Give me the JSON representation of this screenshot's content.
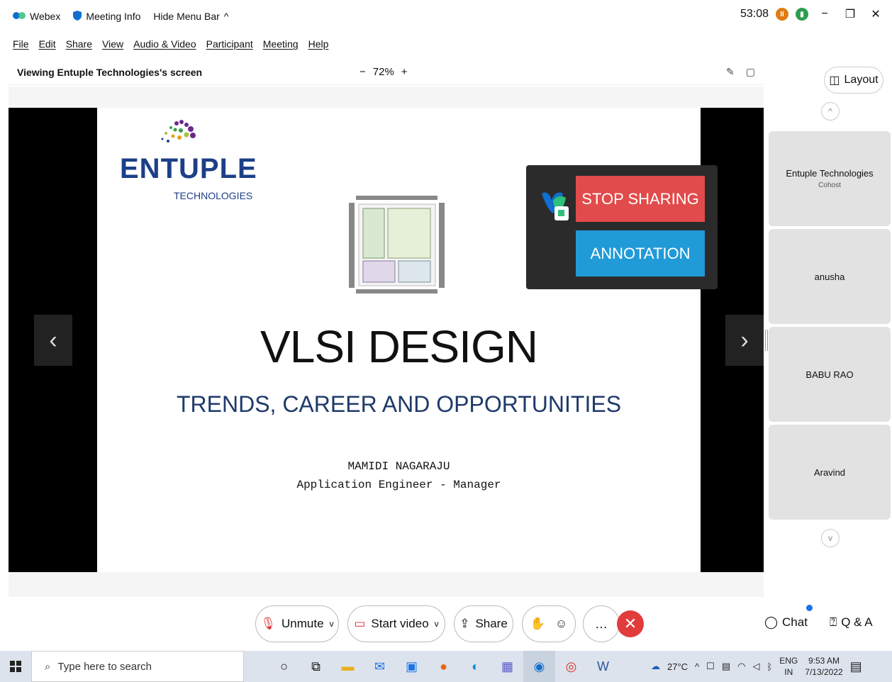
{
  "titlebar": {
    "app_name": "Webex",
    "meeting_info": "Meeting Info",
    "hide_menu": "Hide Menu Bar",
    "timer": "53:08"
  },
  "menu": [
    "File",
    "Edit",
    "Share",
    "View",
    "Audio & Video",
    "Participant",
    "Meeting",
    "Help"
  ],
  "viewbar": {
    "title": "Viewing Entuple Technologies's screen",
    "zoom_minus": "−",
    "zoom": "72%",
    "zoom_plus": "+"
  },
  "slide": {
    "logo_text": "ENTUPLE",
    "logo_sub": "TECHNOLOGIES",
    "title": "VLSI DESIGN",
    "subtitle": "TRENDS, CAREER AND OPPORTUNITIES",
    "author_name": "MAMIDI NAGARAJU",
    "author_role": "Application Engineer - Manager"
  },
  "share_panel": {
    "stop_label": "STOP SHARING",
    "annotation_label": "ANNOTATION"
  },
  "right_panel": {
    "layout_label": "Layout",
    "participants": [
      {
        "name": "Entuple Technologies",
        "role": "Cohost"
      },
      {
        "name": "anusha",
        "role": ""
      },
      {
        "name": "BABU RAO",
        "role": ""
      },
      {
        "name": "Aravind",
        "role": ""
      }
    ]
  },
  "controls": {
    "unmute": "Unmute",
    "start_video": "Start video",
    "share": "Share",
    "chat": "Chat",
    "qa": "Q & A"
  },
  "taskbar": {
    "search_placeholder": "Type here to search",
    "temperature": "27°C",
    "lang_top": "ENG",
    "lang_bottom": "IN",
    "time": "9:53 AM",
    "date": "7/13/2022"
  },
  "colors": {
    "stop_sharing": "#e24b4b",
    "annotation": "#219ad8",
    "end_call": "#e23b3b",
    "brand_blue": "#1d3f87"
  }
}
